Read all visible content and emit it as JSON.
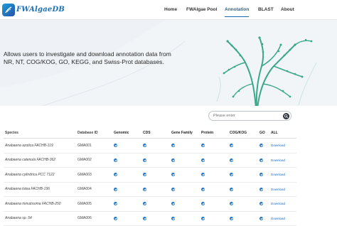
{
  "nav": {
    "logo_text": "FWAlgaeDB",
    "items": [
      {
        "label": "Home"
      },
      {
        "label": "FWAlgae Pool"
      },
      {
        "label": "Annotation",
        "active": true
      },
      {
        "label": "BLAST"
      },
      {
        "label": "About"
      }
    ]
  },
  "banner": {
    "text": "Allows users to investigate and download annotation data from NR, NT, COG/KOG, GO, KEGG, and Swiss-Prot databases."
  },
  "search": {
    "placeholder": "Please enter"
  },
  "table": {
    "headers": [
      "Species",
      "Database ID",
      "Genomic",
      "CDS",
      "Gene Family",
      "Protein",
      "COG/KOG",
      "GO",
      "ALL"
    ],
    "rows": [
      {
        "species": "Anabaena azotica FACHB-119",
        "db_id": "GMA001",
        "all": "Download"
      },
      {
        "species": "Anabaena catenula FACHB-362",
        "db_id": "GMA002",
        "all": "Download"
      },
      {
        "species": "Anabaena cylindrica PCC 7122",
        "db_id": "GMA003",
        "all": "Download"
      },
      {
        "species": "Anabaena lutea FACHB-196",
        "db_id": "GMA004",
        "all": "Download"
      },
      {
        "species": "Anabaena minutissima FACHB-250",
        "db_id": "GMA005",
        "all": "Download"
      },
      {
        "species": "Anabaena sp. 54",
        "db_id": "GMA006",
        "all": "Download"
      }
    ]
  },
  "colors": {
    "accent": "#1766b0",
    "check": "#1a73c9",
    "banner_bg": "#eef1f5",
    "algae": "#3aa889"
  }
}
